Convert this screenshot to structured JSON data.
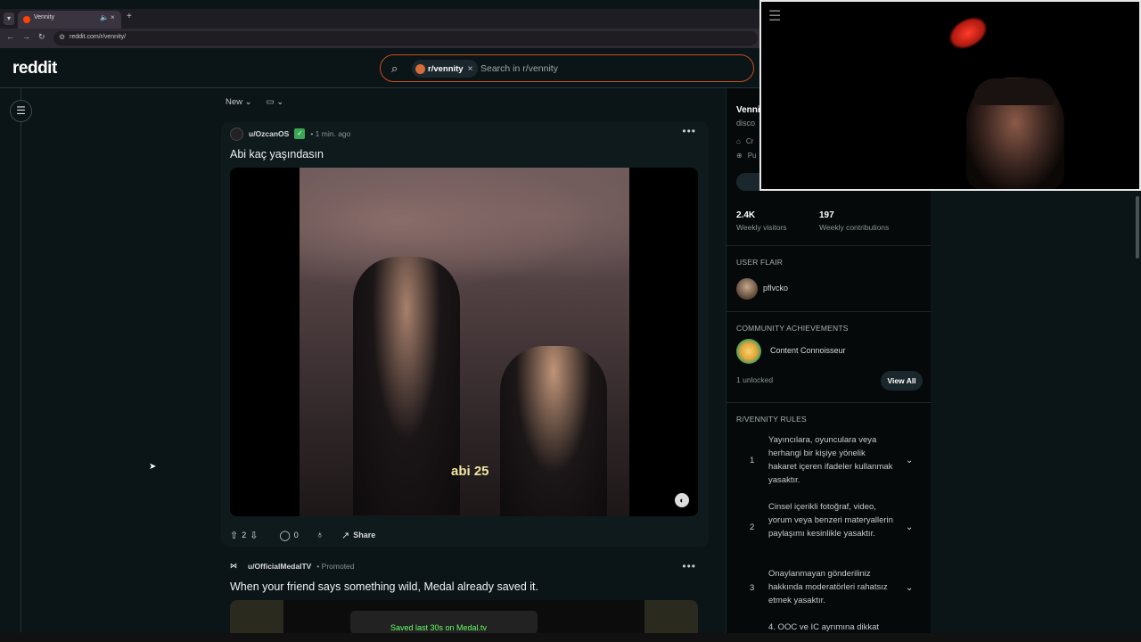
{
  "browser": {
    "tab_title": "Vennity",
    "url": "reddit.com/r/vennity/",
    "new_tab": "+",
    "tab_close": "×"
  },
  "header": {
    "logo": "reddit",
    "search_chip": "r/vennity",
    "search_placeholder": "Search in r/vennity"
  },
  "feed": {
    "sort_label": "New",
    "posts": [
      {
        "author": "u/OzcanOS",
        "time": "• 1 min. ago",
        "title": "Abi kaç yaşındasın",
        "video_caption": "abi 25",
        "votes": "2",
        "comments": "0",
        "share": "Share"
      },
      {
        "author": "u/OfficialMedalTV",
        "tag": "• Promoted",
        "title": "When your friend says something wild, Medal already saved it.",
        "media_text": "Saved last 30s on Medal.tv"
      }
    ]
  },
  "sidebar": {
    "name": "Venni",
    "desc": "disco",
    "created_prefix": "Cr",
    "public_prefix": "Pu",
    "weekly_visitors_value": "2.4K",
    "weekly_visitors_label": "Weekly visitors",
    "weekly_contrib_value": "197",
    "weekly_contrib_label": "Weekly contributions",
    "user_flair_heading": "USER FLAIR",
    "user_flair_name": "pflvcko",
    "achievements_heading": "COMMUNITY ACHIEVEMENTS",
    "achievement_name": "Content Connoisseur",
    "unlocked": "1 unlocked",
    "view_all": "View All",
    "rules_heading": "R/VENNITY RULES",
    "rules": [
      {
        "num": "1",
        "text": "Yayıncılara, oyunculara veya herhangi bir kişiye yönelik hakaret içeren ifadeler kullanmak yasaktır."
      },
      {
        "num": "2",
        "text": "Cinsel içerikli fotoğraf, video, yorum veya benzeri materyallerin paylaşımı kesinlikle yasaktır."
      },
      {
        "num": "3",
        "text": "Onaylanmayan gönderiliniz hakkında moderatörleri rahatsız etmek yasaktır."
      },
      {
        "num": "",
        "text": "4. OOC ve IC ayrımına dikkat"
      }
    ]
  },
  "colors": {
    "background": "#0b1416",
    "accent": "#ff4500",
    "search_border": "#c64f1d"
  }
}
